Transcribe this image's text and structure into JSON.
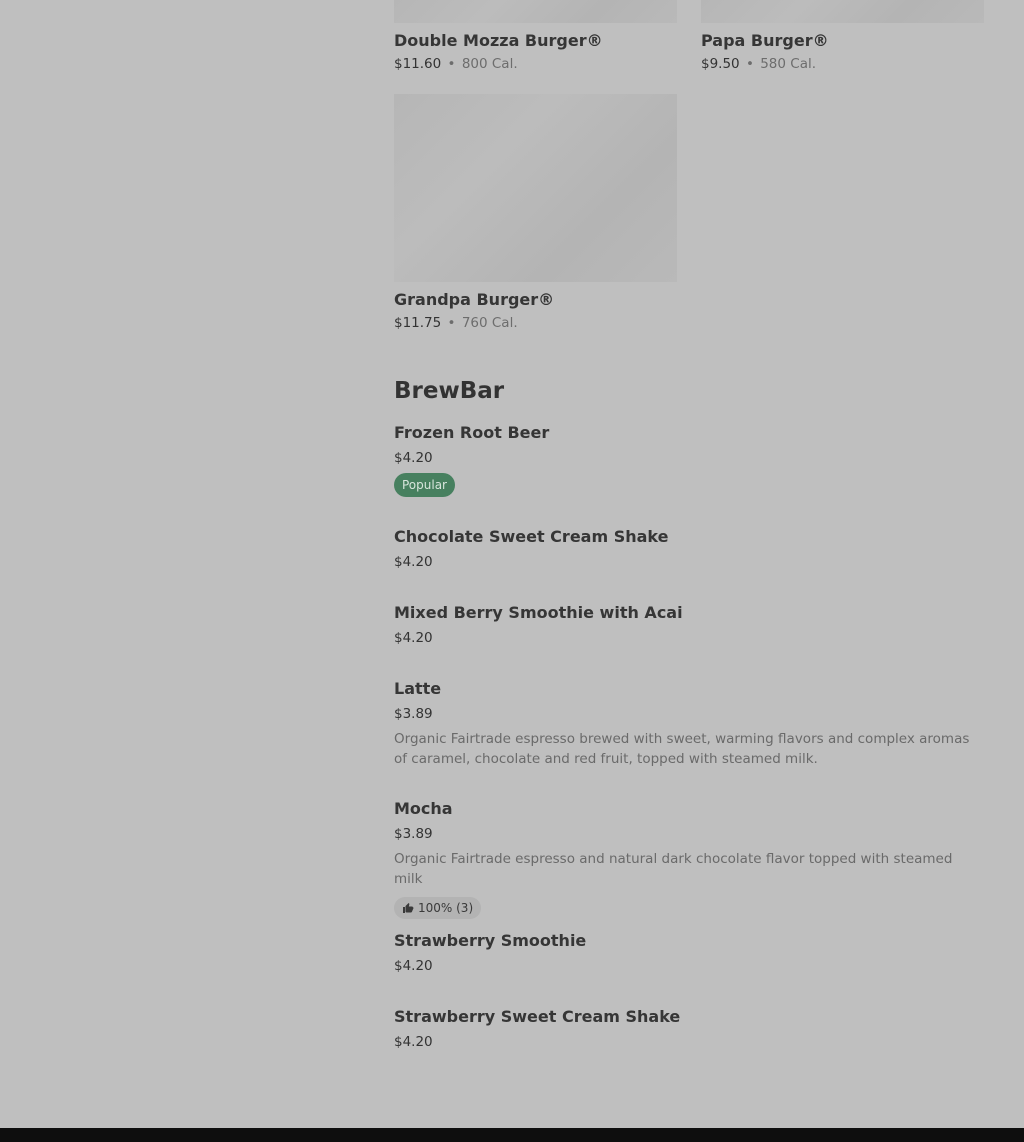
{
  "grid_items": [
    {
      "name": "Double Mozza Burger®",
      "price": "$11.60",
      "separator": "•",
      "calories": "800 Cal."
    },
    {
      "name": "Papa Burger®",
      "price": "$9.50",
      "separator": "•",
      "calories": "580 Cal."
    },
    {
      "name": "Grandpa Burger®",
      "price": "$11.75",
      "separator": "•",
      "calories": "760 Cal."
    }
  ],
  "section": {
    "title": "BrewBar",
    "items": [
      {
        "name": "Frozen Root Beer",
        "price": "$4.20",
        "badge": "Popular"
      },
      {
        "name": "Chocolate Sweet Cream Shake",
        "price": "$4.20"
      },
      {
        "name": "Mixed Berry Smoothie with Acai",
        "price": "$4.20"
      },
      {
        "name": "Latte",
        "price": "$3.89",
        "description": "Organic Fairtrade espresso brewed with sweet, warming flavors and complex aromas of caramel, chocolate and red fruit, topped with steamed milk."
      },
      {
        "name": "Mocha",
        "price": "$3.89",
        "description": "Organic Fairtrade espresso and natural dark chocolate flavor topped with steamed milk",
        "rating": "100% (3)",
        "rating_icon": "thumbs-up-icon"
      },
      {
        "name": "Strawberry Smoothie",
        "price": "$4.20"
      },
      {
        "name": "Strawberry Sweet Cream Shake",
        "price": "$4.20"
      }
    ]
  },
  "colors": {
    "overlay_background": "#bfbfbf",
    "popular_badge": "#47805f",
    "footer": "#0e0e0e"
  }
}
